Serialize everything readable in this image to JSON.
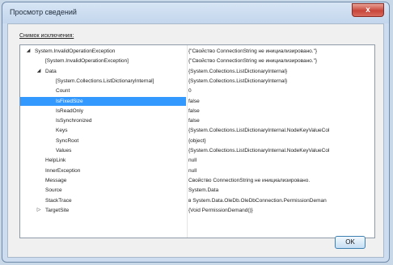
{
  "window": {
    "title": "Просмотр сведений",
    "close_label": "x"
  },
  "group_label": "Снимок исключения:",
  "rows": [
    {
      "indent": 0,
      "expander": "◢",
      "name": "System.InvalidOperationException",
      "value": "{\"Свойство ConnectionString не инициализировано.\"}"
    },
    {
      "indent": 1,
      "expander": "",
      "name": "[System.InvalidOperationException]",
      "value": "{\"Свойство ConnectionString не инициализировано.\"}"
    },
    {
      "indent": 1,
      "expander": "◢",
      "name": "Data",
      "value": "{System.Collections.ListDictionaryInternal}"
    },
    {
      "indent": 2,
      "expander": "",
      "name": "[System.Collections.ListDictionaryInternal]",
      "value": "{System.Collections.ListDictionaryInternal}"
    },
    {
      "indent": 2,
      "expander": "",
      "name": "Count",
      "value": "0"
    },
    {
      "indent": 2,
      "expander": "",
      "name": "IsFixedSize",
      "value": "false",
      "selected": true
    },
    {
      "indent": 2,
      "expander": "",
      "name": "IsReadOnly",
      "value": "false"
    },
    {
      "indent": 2,
      "expander": "",
      "name": "IsSynchronized",
      "value": "false"
    },
    {
      "indent": 2,
      "expander": "",
      "name": "Keys",
      "value": "{System.Collections.ListDictionaryInternal.NodeKeyValueCol"
    },
    {
      "indent": 2,
      "expander": "",
      "name": "SyncRoot",
      "value": "{object}"
    },
    {
      "indent": 2,
      "expander": "",
      "name": "Values",
      "value": "{System.Collections.ListDictionaryInternal.NodeKeyValueCol"
    },
    {
      "indent": 1,
      "expander": "",
      "name": "HelpLink",
      "value": "null"
    },
    {
      "indent": 1,
      "expander": "",
      "name": "InnerException",
      "value": "null"
    },
    {
      "indent": 1,
      "expander": "",
      "name": "Message",
      "value": "Свойство ConnectionString не инициализировано."
    },
    {
      "indent": 1,
      "expander": "",
      "name": "Source",
      "value": "System.Data"
    },
    {
      "indent": 1,
      "expander": "",
      "name": "StackTrace",
      "value": "  в System.Data.OleDb.OleDbConnection.PermissionDeman"
    },
    {
      "indent": 1,
      "expander": "▷",
      "name": "TargetSite",
      "value": "{Void PermissionDemand()}"
    }
  ],
  "ok_button": "OK"
}
